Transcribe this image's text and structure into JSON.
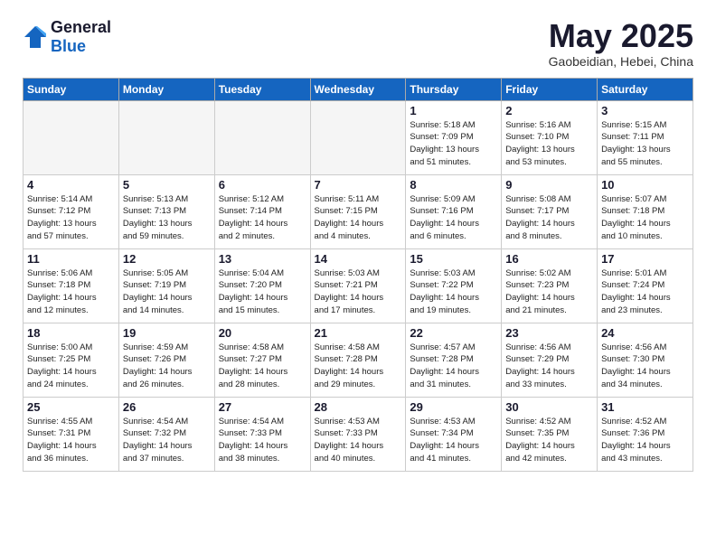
{
  "logo": {
    "general": "General",
    "blue": "Blue"
  },
  "title": "May 2025",
  "location": "Gaobeidian, Hebei, China",
  "weekdays": [
    "Sunday",
    "Monday",
    "Tuesday",
    "Wednesday",
    "Thursday",
    "Friday",
    "Saturday"
  ],
  "weeks": [
    [
      {
        "day": "",
        "info": ""
      },
      {
        "day": "",
        "info": ""
      },
      {
        "day": "",
        "info": ""
      },
      {
        "day": "",
        "info": ""
      },
      {
        "day": "1",
        "info": "Sunrise: 5:18 AM\nSunset: 7:09 PM\nDaylight: 13 hours\nand 51 minutes."
      },
      {
        "day": "2",
        "info": "Sunrise: 5:16 AM\nSunset: 7:10 PM\nDaylight: 13 hours\nand 53 minutes."
      },
      {
        "day": "3",
        "info": "Sunrise: 5:15 AM\nSunset: 7:11 PM\nDaylight: 13 hours\nand 55 minutes."
      }
    ],
    [
      {
        "day": "4",
        "info": "Sunrise: 5:14 AM\nSunset: 7:12 PM\nDaylight: 13 hours\nand 57 minutes."
      },
      {
        "day": "5",
        "info": "Sunrise: 5:13 AM\nSunset: 7:13 PM\nDaylight: 13 hours\nand 59 minutes."
      },
      {
        "day": "6",
        "info": "Sunrise: 5:12 AM\nSunset: 7:14 PM\nDaylight: 14 hours\nand 2 minutes."
      },
      {
        "day": "7",
        "info": "Sunrise: 5:11 AM\nSunset: 7:15 PM\nDaylight: 14 hours\nand 4 minutes."
      },
      {
        "day": "8",
        "info": "Sunrise: 5:09 AM\nSunset: 7:16 PM\nDaylight: 14 hours\nand 6 minutes."
      },
      {
        "day": "9",
        "info": "Sunrise: 5:08 AM\nSunset: 7:17 PM\nDaylight: 14 hours\nand 8 minutes."
      },
      {
        "day": "10",
        "info": "Sunrise: 5:07 AM\nSunset: 7:18 PM\nDaylight: 14 hours\nand 10 minutes."
      }
    ],
    [
      {
        "day": "11",
        "info": "Sunrise: 5:06 AM\nSunset: 7:18 PM\nDaylight: 14 hours\nand 12 minutes."
      },
      {
        "day": "12",
        "info": "Sunrise: 5:05 AM\nSunset: 7:19 PM\nDaylight: 14 hours\nand 14 minutes."
      },
      {
        "day": "13",
        "info": "Sunrise: 5:04 AM\nSunset: 7:20 PM\nDaylight: 14 hours\nand 15 minutes."
      },
      {
        "day": "14",
        "info": "Sunrise: 5:03 AM\nSunset: 7:21 PM\nDaylight: 14 hours\nand 17 minutes."
      },
      {
        "day": "15",
        "info": "Sunrise: 5:03 AM\nSunset: 7:22 PM\nDaylight: 14 hours\nand 19 minutes."
      },
      {
        "day": "16",
        "info": "Sunrise: 5:02 AM\nSunset: 7:23 PM\nDaylight: 14 hours\nand 21 minutes."
      },
      {
        "day": "17",
        "info": "Sunrise: 5:01 AM\nSunset: 7:24 PM\nDaylight: 14 hours\nand 23 minutes."
      }
    ],
    [
      {
        "day": "18",
        "info": "Sunrise: 5:00 AM\nSunset: 7:25 PM\nDaylight: 14 hours\nand 24 minutes."
      },
      {
        "day": "19",
        "info": "Sunrise: 4:59 AM\nSunset: 7:26 PM\nDaylight: 14 hours\nand 26 minutes."
      },
      {
        "day": "20",
        "info": "Sunrise: 4:58 AM\nSunset: 7:27 PM\nDaylight: 14 hours\nand 28 minutes."
      },
      {
        "day": "21",
        "info": "Sunrise: 4:58 AM\nSunset: 7:28 PM\nDaylight: 14 hours\nand 29 minutes."
      },
      {
        "day": "22",
        "info": "Sunrise: 4:57 AM\nSunset: 7:28 PM\nDaylight: 14 hours\nand 31 minutes."
      },
      {
        "day": "23",
        "info": "Sunrise: 4:56 AM\nSunset: 7:29 PM\nDaylight: 14 hours\nand 33 minutes."
      },
      {
        "day": "24",
        "info": "Sunrise: 4:56 AM\nSunset: 7:30 PM\nDaylight: 14 hours\nand 34 minutes."
      }
    ],
    [
      {
        "day": "25",
        "info": "Sunrise: 4:55 AM\nSunset: 7:31 PM\nDaylight: 14 hours\nand 36 minutes."
      },
      {
        "day": "26",
        "info": "Sunrise: 4:54 AM\nSunset: 7:32 PM\nDaylight: 14 hours\nand 37 minutes."
      },
      {
        "day": "27",
        "info": "Sunrise: 4:54 AM\nSunset: 7:33 PM\nDaylight: 14 hours\nand 38 minutes."
      },
      {
        "day": "28",
        "info": "Sunrise: 4:53 AM\nSunset: 7:33 PM\nDaylight: 14 hours\nand 40 minutes."
      },
      {
        "day": "29",
        "info": "Sunrise: 4:53 AM\nSunset: 7:34 PM\nDaylight: 14 hours\nand 41 minutes."
      },
      {
        "day": "30",
        "info": "Sunrise: 4:52 AM\nSunset: 7:35 PM\nDaylight: 14 hours\nand 42 minutes."
      },
      {
        "day": "31",
        "info": "Sunrise: 4:52 AM\nSunset: 7:36 PM\nDaylight: 14 hours\nand 43 minutes."
      }
    ]
  ]
}
